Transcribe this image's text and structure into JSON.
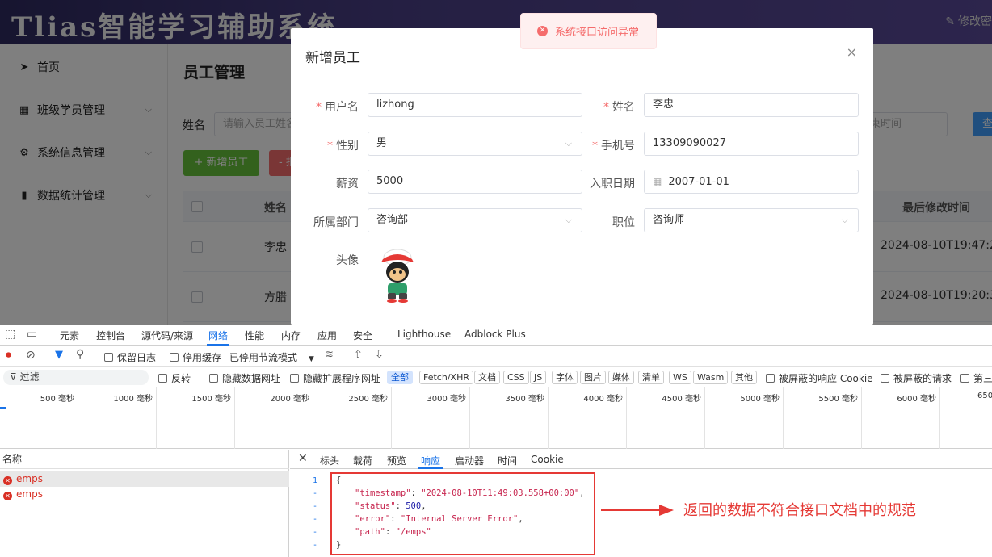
{
  "app": {
    "title": "Tlias智能学习辅助系统",
    "header_right": "修改密",
    "sidebar": [
      {
        "label": "首页",
        "icon": "paper-plane-icon",
        "glyph": "➤"
      },
      {
        "label": "班级学员管理",
        "icon": "grid-icon",
        "glyph": "▦"
      },
      {
        "label": "系统信息管理",
        "icon": "gear-icon",
        "glyph": "⚙"
      },
      {
        "label": "数据统计管理",
        "icon": "bar-chart-icon",
        "glyph": "▮"
      }
    ],
    "main": {
      "title": "员工管理",
      "search_label": "姓名",
      "search_placeholder": "请输入员工姓名",
      "date_end_placeholder": "束时间",
      "query_label": "查",
      "add_button": "+ 新增员工",
      "delete_button": "- 批",
      "table": {
        "col_name": "姓名",
        "col_modified": "最后修改时间",
        "rows": [
          {
            "name": "李忠",
            "modified": "2024-08-10T19:47:26"
          },
          {
            "name": "方腊",
            "modified": "2024-08-10T19:20:39"
          }
        ]
      }
    },
    "toast": "系统接口访问异常",
    "dialog": {
      "title": "新增员工",
      "close": "×",
      "fields": {
        "username": {
          "label": "用户名",
          "value": "lizhong",
          "required": "*"
        },
        "realname": {
          "label": "姓名",
          "value": "李忠",
          "required": "*"
        },
        "gender": {
          "label": "性别",
          "value": "男",
          "required": "*"
        },
        "phone": {
          "label": "手机号",
          "value": "13309090027",
          "required": "*"
        },
        "salary": {
          "label": "薪资",
          "value": "5000"
        },
        "entry_date": {
          "label": "入职日期",
          "value": "2007-01-01"
        },
        "dept": {
          "label": "所属部门",
          "value": "咨询部"
        },
        "position": {
          "label": "职位",
          "value": "咨询师"
        },
        "avatar": {
          "label": "头像"
        }
      }
    }
  },
  "devtools": {
    "tabs": [
      "元素",
      "控制台",
      "源代码/来源",
      "网络",
      "性能",
      "内存",
      "应用",
      "安全",
      "Lighthouse",
      "Adblock Plus"
    ],
    "active_tab": "网络",
    "toolbar": {
      "preserve_log": "保留日志",
      "disable_cache": "停用缓存",
      "throttle": "已停用节流模式"
    },
    "filter": {
      "placeholder": "过滤",
      "invert": "反转",
      "hide_data_urls": "隐藏数据网址",
      "hide_ext_urls": "隐藏扩展程序网址",
      "types": [
        "全部",
        "Fetch/XHR",
        "文档",
        "CSS",
        "JS",
        "字体",
        "图片",
        "媒体",
        "清单",
        "WS",
        "Wasm",
        "其他"
      ],
      "blocked_cookies": "被屏蔽的响应 Cookie",
      "blocked_requests": "被屏蔽的请求",
      "third_party": "第三"
    },
    "timeline_ticks": [
      "500 毫秒",
      "1000 毫秒",
      "1500 毫秒",
      "2000 毫秒",
      "2500 毫秒",
      "3000 毫秒",
      "3500 毫秒",
      "4000 毫秒",
      "4500 毫秒",
      "5000 毫秒",
      "5500 毫秒",
      "6000 毫秒",
      "650"
    ],
    "requests_header": "名称",
    "requests": [
      "emps",
      "emps"
    ],
    "detail_tabs": [
      "标头",
      "载荷",
      "预览",
      "响应",
      "启动器",
      "时间",
      "Cookie"
    ],
    "active_detail_tab": "响应",
    "response_lines": {
      "l1": "{",
      "l2_key": "\"timestamp\"",
      "l2_val": "\"2024-08-10T11:49:03.558+00:00\"",
      "l3_key": "\"status\"",
      "l3_val": "500",
      "l4_key": "\"error\"",
      "l4_val": "\"Internal Server Error\"",
      "l5_key": "\"path\"",
      "l5_val": "\"/emps\"",
      "l6": "}"
    },
    "line_numbers": [
      "1",
      "-",
      "-",
      "-",
      "-",
      "-"
    ],
    "annotation": "返回的数据不符合接口文档中的规范"
  }
}
